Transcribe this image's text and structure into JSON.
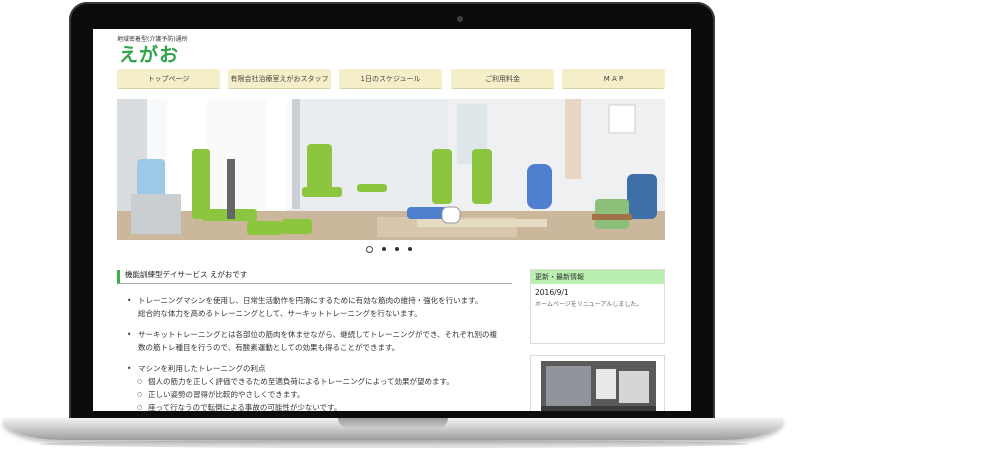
{
  "site": {
    "subtitle": "地域密着型(介護予防)通所",
    "logo_text": "えがお"
  },
  "nav": {
    "items": [
      {
        "label": "トップページ"
      },
      {
        "label": "有限会社治療室えがおスタッフ"
      },
      {
        "label": "1日のスケジュール"
      },
      {
        "label": "ご利用料金"
      },
      {
        "label": "M A P"
      }
    ]
  },
  "slider": {
    "dot_count": 4,
    "active_index": 0
  },
  "main": {
    "heading": "機能訓練型デイサービス えがおです",
    "paragraphs": [
      {
        "line1": "トレーニングマシンを使用し、日常生活動作を円滑にするために有効な筋肉の維持・強化を行います。",
        "line2": "総合的な体力を高めるトレーニングとして、サーキットトレーニングを行ないます。"
      },
      {
        "line1": "サーキットトレーニングとは各部位の筋肉を休ませながら、継続してトレーニングができ、それぞれ別の複",
        "line2": "数の筋トレ種目を行うので、有酸素運動としての効果も得ることができます。"
      }
    ],
    "benefits_title": "マシンを利用したトレーニングの利点",
    "benefits": [
      "個人の筋力を正しく評価できるため至適負荷によるトレーニングによって効果が望めます。",
      "正しい姿勢の習得が比較的やさしくできます。",
      "座って行なうので転倒による事故の可能性が少ないです。"
    ]
  },
  "news": {
    "header": "更新・最新情報",
    "date": "2016/9/1",
    "text": "ホームページをリニューアルしました。"
  },
  "colors": {
    "accent_green": "#39b14b",
    "nav_bg": "#f4efc8",
    "news_header_bg": "#b9f0b0"
  }
}
